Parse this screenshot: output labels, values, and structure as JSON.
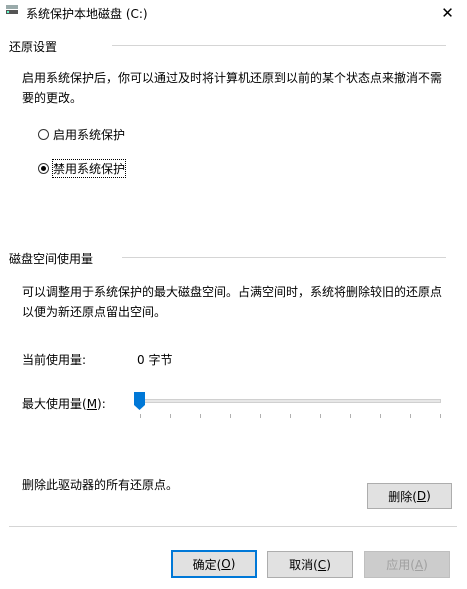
{
  "window": {
    "title": "系统保护本地磁盘 (C:)",
    "close_glyph": "✕"
  },
  "restore": {
    "group_title": "还原设置",
    "description_line1": "启用系统保护后，你可以通过及时将计算机还原到以前的某个状态点来撤消不需",
    "description_line2": "要的更改。",
    "options": [
      {
        "label": "启用系统保护",
        "selected": false
      },
      {
        "label": "禁用系统保护",
        "selected": true
      }
    ]
  },
  "disk": {
    "group_title": "磁盘空间使用量",
    "description_line1": "可以调整用于系统保护的最大磁盘空间。占满空间时，系统将删除较旧的还原点",
    "description_line2": "以便为新还原点留出空间。",
    "current_usage_label": "当前使用量:",
    "current_usage_value": "0 字节",
    "max_usage_label": "最大使用量(",
    "max_usage_key": "M",
    "max_usage_suffix": "):",
    "max_usage_percent": 0
  },
  "delete": {
    "description": "删除此驱动器的所有还原点。",
    "button_label": "删除(",
    "button_key": "D",
    "button_suffix": ")"
  },
  "footer": {
    "ok_label": "确定(",
    "ok_key": "O",
    "ok_suffix": ")",
    "cancel_label": "取消(",
    "cancel_key": "C",
    "cancel_suffix": ")",
    "apply_label": "应用(",
    "apply_key": "A",
    "apply_suffix": ")"
  },
  "colors": {
    "accent": "#0078d7",
    "button_bg": "#e1e1e1",
    "disabled_text": "#a0a0a0"
  }
}
